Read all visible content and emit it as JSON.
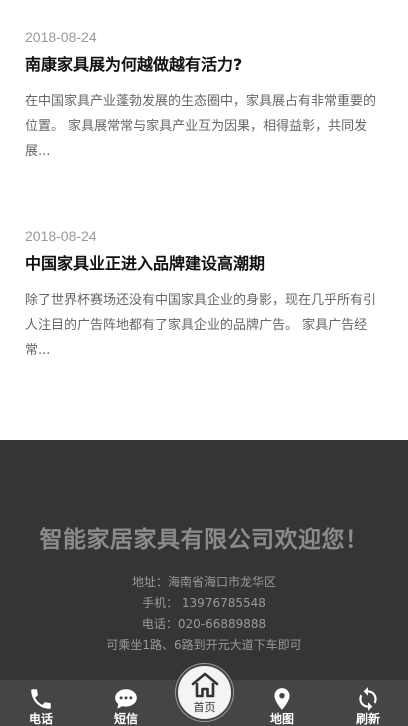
{
  "articles": [
    {
      "date": "2018-08-24",
      "title": "南康家具展为何越做越有活力?",
      "summary": "在中国家具产业蓬勃发展的生态圈中，家具展占有非常重要的位置。 家具展常常与家具产业互为因果，相得益彰，共同发展..."
    },
    {
      "date": "2018-08-24",
      "title": "中国家具业正进入品牌建设高潮期",
      "summary": "除了世界杯赛场还没有中国家具企业的身影，现在几乎所有引人注目的广告阵地都有了家具企业的品牌广告。 家具广告经常..."
    }
  ],
  "footer": {
    "welcome": "智能家居家具有限公司欢迎您！",
    "address": "地址：海南省海口市龙华区",
    "mobile": "手机： 13976785548",
    "phone": "电话：020-66889888",
    "transit": "可乘坐1路、6路到开元大道下车即可"
  },
  "navbar": {
    "phone_label": "电话",
    "sms_label": "短信",
    "home_label": "首页",
    "map_label": "地图",
    "refresh_label": "刷新",
    "phone_icon": "phone-icon",
    "sms_icon": "chat-bubble-icon",
    "home_icon": "home-icon",
    "map_icon": "map-pin-icon",
    "refresh_icon": "refresh-icon"
  },
  "colors": {
    "footer_bg": "#353535",
    "navbar_bg": "#454545",
    "welcome_text": "#8b8b8b"
  }
}
